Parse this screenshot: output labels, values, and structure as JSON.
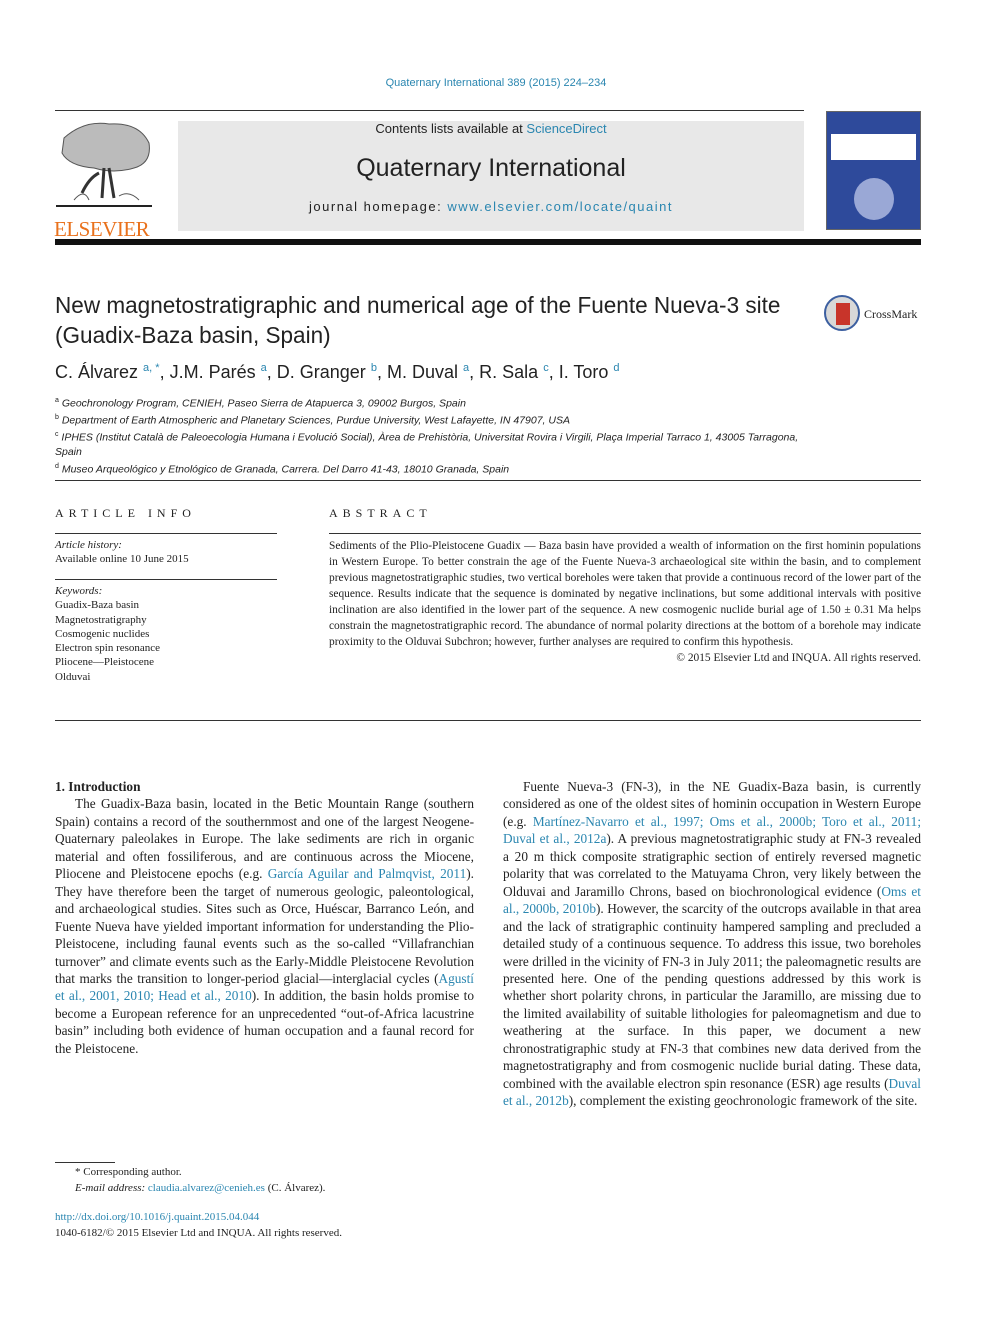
{
  "journal_ref": "Quaternary International 389 (2015) 224–234",
  "header": {
    "publisher_logo_text": "ELSEVIER",
    "contents_prefix": "Contents lists available at ",
    "contents_link": "ScienceDirect",
    "journal_title": "Quaternary International",
    "homepage_prefix": "journal homepage: ",
    "homepage_link": "www.elsevier.com/locate/quaint",
    "cover_icon": "journal-cover-image"
  },
  "article": {
    "title": "New magnetostratigraphic and numerical age of the Fuente Nueva-3 site (Guadix-Baza basin, Spain)",
    "crossmark_label": "CrossMark",
    "authors": [
      {
        "name": "C. Álvarez",
        "sup": "a, *"
      },
      {
        "name": "J.M. Parés",
        "sup": "a"
      },
      {
        "name": "D. Granger",
        "sup": "b"
      },
      {
        "name": "M. Duval",
        "sup": "a"
      },
      {
        "name": "R. Sala",
        "sup": "c"
      },
      {
        "name": "I. Toro",
        "sup": "d"
      }
    ],
    "affiliations": [
      {
        "key": "a",
        "text": "Geochronology Program, CENIEH, Paseo Sierra de Atapuerca 3, 09002 Burgos, Spain"
      },
      {
        "key": "b",
        "text": "Department of Earth Atmospheric and Planetary Sciences, Purdue University, West Lafayette, IN 47907, USA"
      },
      {
        "key": "c",
        "text": "IPHES (Institut Català de Paleoecologia Humana i Evolució Social), Àrea de Prehistòria, Universitat Rovira i Virgili, Plaça Imperial Tarraco 1, 43005 Tarragona, Spain"
      },
      {
        "key": "d",
        "text": "Museo Arqueológico y Etnológico de Granada, Carrera. Del Darro 41-43, 18010 Granada, Spain"
      }
    ]
  },
  "article_info": {
    "heading": "ARTICLE INFO",
    "history_label": "Article history:",
    "history_value": "Available online 10 June 2015",
    "keywords_label": "Keywords:",
    "keywords": [
      "Guadix-Baza basin",
      "Magnetostratigraphy",
      "Cosmogenic nuclides",
      "Electron spin resonance",
      "Pliocene—Pleistocene",
      "Olduvai"
    ]
  },
  "abstract": {
    "heading": "ABSTRACT",
    "text": "Sediments of the Plio-Pleistocene Guadix — Baza basin have provided a wealth of information on the first hominin populations in Western Europe. To better constrain the age of the Fuente Nueva-3 archaeological site within the basin, and to complement previous magnetostratigraphic studies, two vertical boreholes were taken that provide a continuous record of the lower part of the sequence. Results indicate that the sequence is dominated by negative inclinations, but some additional intervals with positive inclination are also identified in the lower part of the sequence. A new cosmogenic nuclide burial age of 1.50 ± 0.31 Ma helps constrain the magnetostratigraphic record. The abundance of normal polarity directions at the bottom of a borehole may indicate proximity to the Olduvai Subchron; however, further analyses are required to confirm this hypothesis.",
    "copyright": "© 2015 Elsevier Ltd and INQUA. All rights reserved."
  },
  "intro": {
    "heading": "1.  Introduction",
    "p1": [
      {
        "t": "The Guadix-Baza basin, located in the Betic Mountain Range (southern Spain) contains a record of the southernmost and one of the largest Neogene-Quaternary paleolakes in Europe. The lake sediments are rich in organic material and often fossiliferous, and are continuous across the Miocene, Pliocene and Pleistocene epochs (e.g. "
      },
      {
        "t": "García Aguilar and Palmqvist, 2011",
        "link": true
      },
      {
        "t": "). They have therefore been the target of numerous geologic, paleontological, and archaeological studies. Sites such as Orce, Huéscar, Barranco León, and Fuente Nueva have yielded important information for understanding the Plio-Pleistocene, including faunal events such as the so-called “Villafranchian turnover” and climate events such as the Early-Middle Pleistocene Revolution that marks the transition to longer-period glacial—interglacial cycles ("
      },
      {
        "t": "Agustí et al., 2001, 2010; Head et al., 2010",
        "link": true
      },
      {
        "t": "). In addition, the basin holds promise to become a European reference for an unprecedented “out-of-Africa lacustrine basin” including both evidence of human occupation and a faunal record for the Pleistocene."
      }
    ],
    "p2": [
      {
        "t": "Fuente Nueva-3 (FN-3), in the NE Guadix-Baza basin, is currently considered as one of the oldest sites of hominin occupation in Western Europe (e.g. "
      },
      {
        "t": "Martínez-Navarro et al., 1997; Oms et al., 2000b; Toro et al., 2011; Duval et al., 2012a",
        "link": true
      },
      {
        "t": "). A previous magnetostratigraphic study at FN-3 revealed a 20 m thick composite stratigraphic section of entirely reversed magnetic polarity that was correlated to the Matuyama Chron, very likely between the Olduvai and Jaramillo Chrons, based on biochronological evidence ("
      },
      {
        "t": "Oms et al., 2000b, 2010b",
        "link": true
      },
      {
        "t": "). However, the scarcity of the outcrops available in that area and the lack of stratigraphic continuity hampered sampling and precluded a detailed study of a continuous sequence. To address this issue, two boreholes were drilled in the vicinity of FN-3 in July 2011; the paleomagnetic results are presented here. One of the pending questions addressed by this work is whether short polarity chrons, in particular the Jaramillo, are missing due to the limited availability of suitable lithologies for paleomagnetism and due to weathering at the surface. In this paper, we document a new chronostratigraphic study at FN-3 that combines new data derived from the magnetostratigraphy and from cosmogenic nuclide burial dating. These data, combined with the available electron spin resonance (ESR) age results ("
      },
      {
        "t": "Duval et al., 2012b",
        "link": true
      },
      {
        "t": "), complement the existing geochronologic framework of the site."
      }
    ]
  },
  "footnote": {
    "corresponding": "* Corresponding author.",
    "email_label": "E-mail address: ",
    "email": "claudia.alvarez@cenieh.es",
    "email_suffix": " (C. Álvarez)."
  },
  "doi": {
    "url": "http://dx.doi.org/10.1016/j.quaint.2015.04.044",
    "issn_line": "1040-6182/© 2015 Elsevier Ltd and INQUA. All rights reserved."
  },
  "colors": {
    "link": "#2a86b0",
    "elsevier_orange": "#e9711c",
    "banner_gray": "#e8e8e8",
    "cover_blue": "#2e4a9b"
  }
}
